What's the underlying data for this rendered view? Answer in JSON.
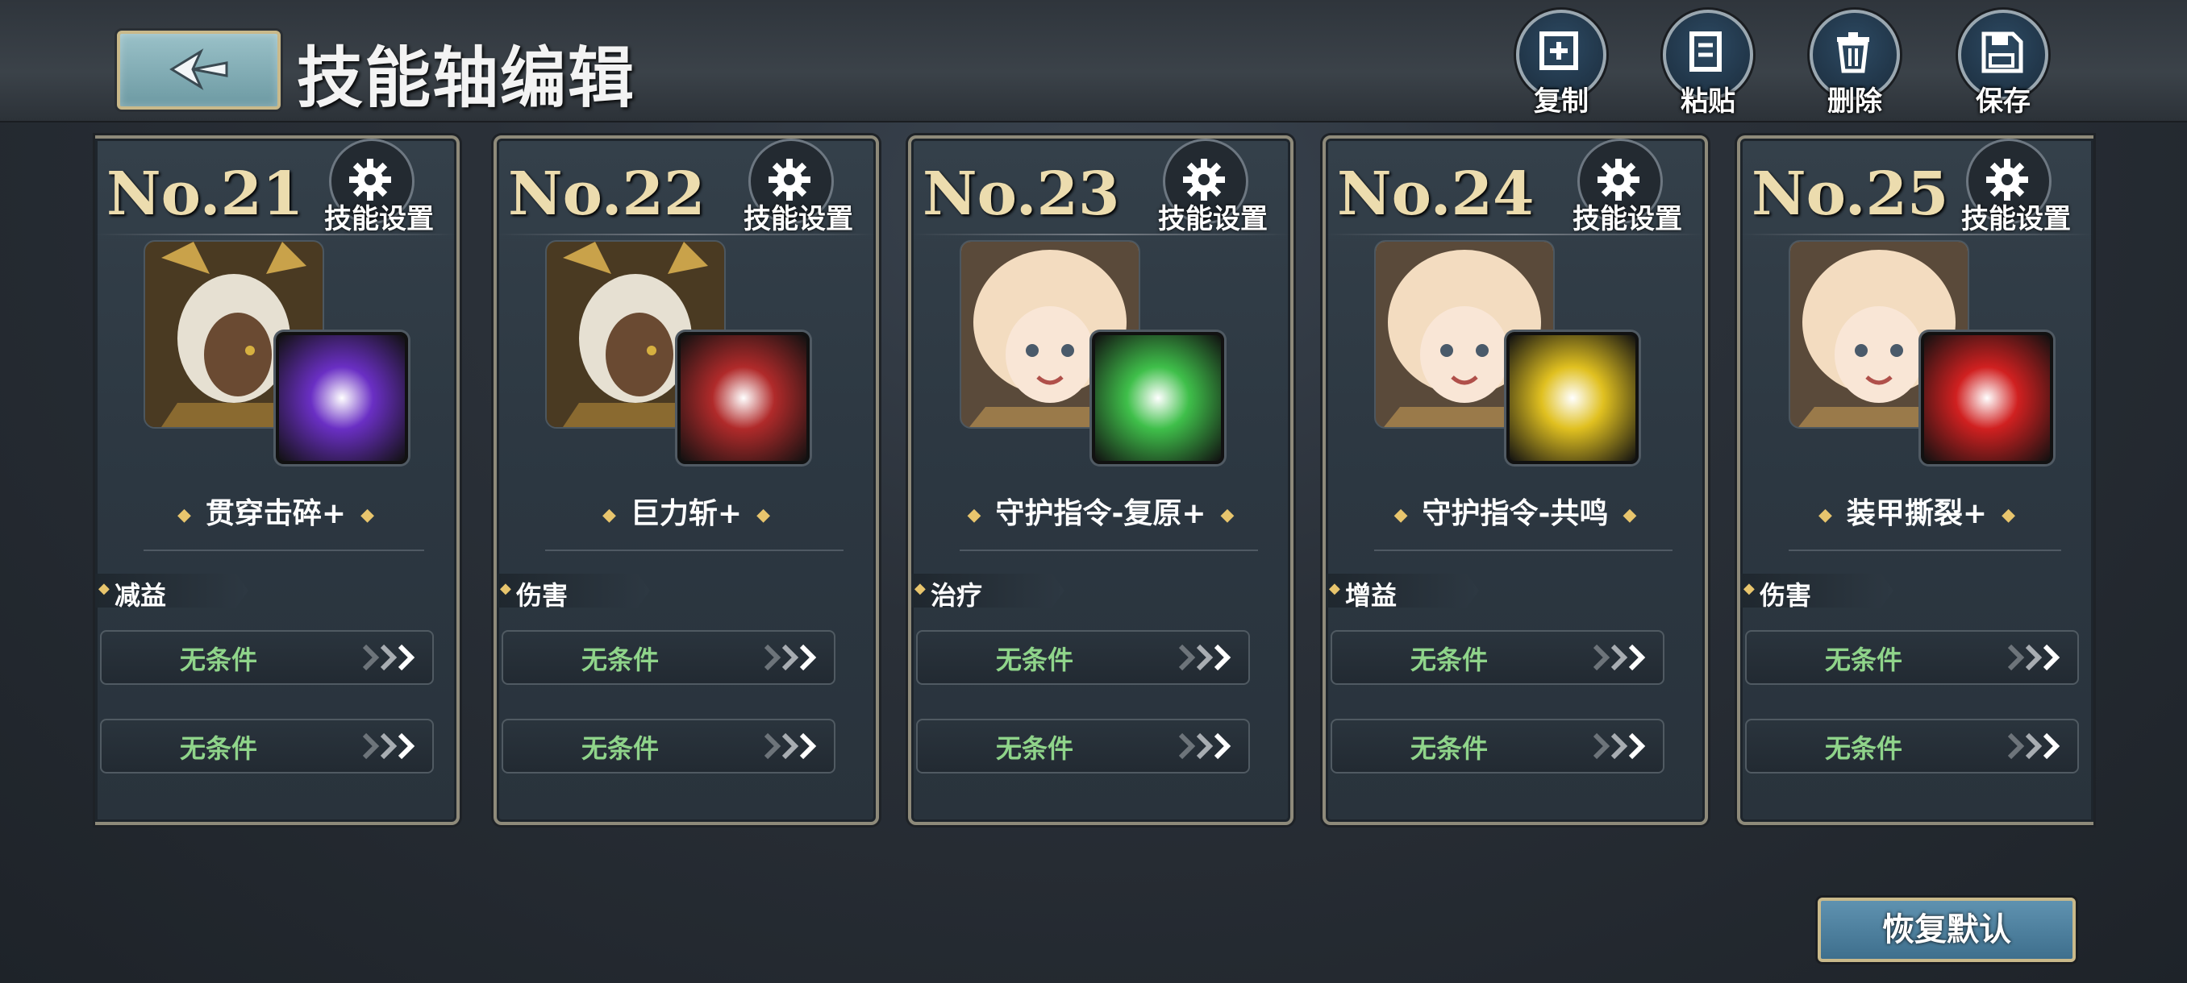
{
  "header": {
    "title": "技能轴编辑",
    "tools": [
      {
        "label": "复制",
        "icon": "copy-icon"
      },
      {
        "label": "粘贴",
        "icon": "paste-icon"
      },
      {
        "label": "删除",
        "icon": "trash-icon"
      },
      {
        "label": "保存",
        "icon": "save-icon"
      }
    ]
  },
  "cards": [
    {
      "number": "No.21",
      "settings_label": "技能设置",
      "skill": "贯穿击碎+",
      "tag": "减益",
      "conditions": [
        "无条件",
        "无条件"
      ],
      "portrait": "dark-haired-warrior",
      "skill_color": "#6a2fc4"
    },
    {
      "number": "No.22",
      "settings_label": "技能设置",
      "skill": "巨力斩+",
      "tag": "伤害",
      "conditions": [
        "无条件",
        "无条件"
      ],
      "portrait": "dark-haired-warrior",
      "skill_color": "#b02a2a"
    },
    {
      "number": "No.23",
      "settings_label": "技能设置",
      "skill": "守护指令-复原+",
      "tag": "治疗",
      "conditions": [
        "无条件",
        "无条件"
      ],
      "portrait": "blonde-girl",
      "skill_color": "#3fbf4a"
    },
    {
      "number": "No.24",
      "settings_label": "技能设置",
      "skill": "守护指令-共鸣",
      "tag": "增益",
      "conditions": [
        "无条件",
        "无条件"
      ],
      "portrait": "blonde-girl",
      "skill_color": "#e0c020"
    },
    {
      "number": "No.25",
      "settings_label": "技能设置",
      "skill": "装甲撕裂+",
      "tag": "伤害",
      "conditions": [
        "无条件",
        "无条件"
      ],
      "portrait": "blonde-girl",
      "skill_color": "#d02020"
    }
  ],
  "footer": {
    "restore_label": "恢复默认"
  },
  "colors": {
    "condition_text": "#8fd48a",
    "accent_gold": "#e8c56d"
  }
}
